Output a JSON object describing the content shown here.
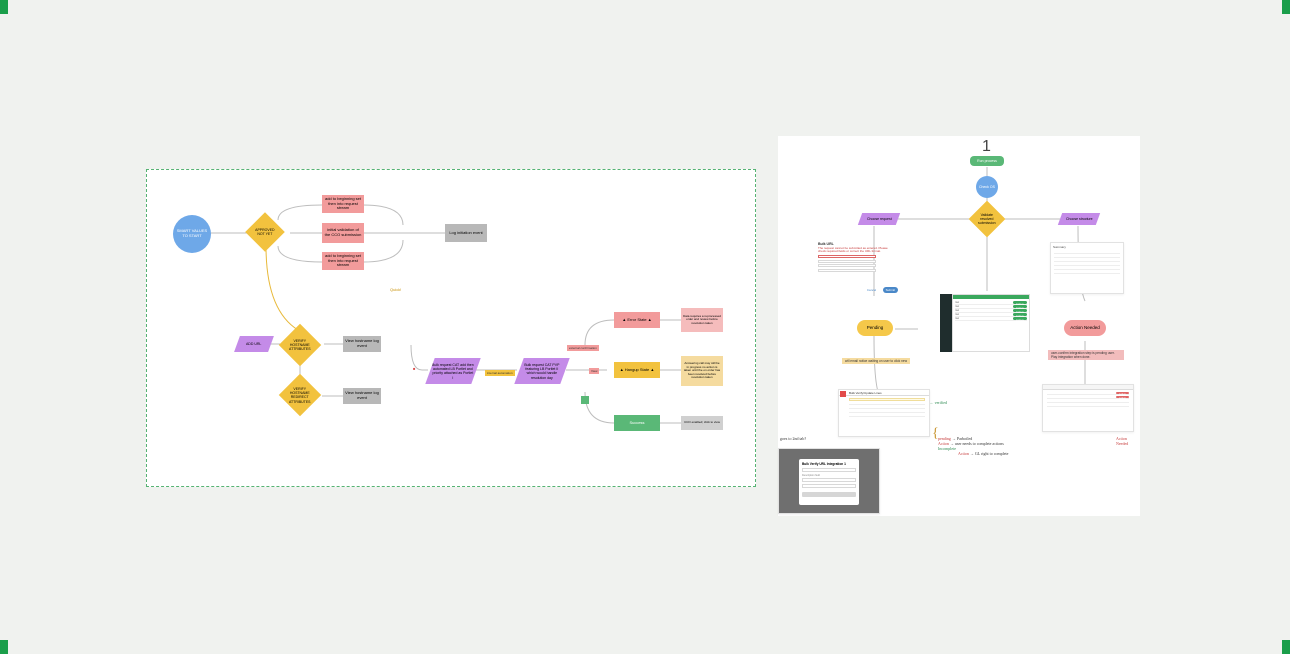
{
  "left": {
    "start": "SMART VALUES TO START",
    "d1": "APPROVED NOT YET",
    "pink1": "add to beginning set then into request stream",
    "pink2": "initial validation of the CCO submission",
    "pink3": "add to beginning set then into request stream",
    "grey1": "Log initiation event",
    "p_addurl": "ADD URL",
    "d2": "VERIFY HOSTNAME ATTRIBUTES",
    "grey2": "View hostname log event",
    "d3": "VERIFY HOSTNAME REDIRECT ATTRIBUTES",
    "grey3": "View hostname log event",
    "p_sendcat": "Bulk request CAT add then automated LB Portlet and priority attached as Portlet I",
    "p_sendcat2": "Bulk request CAT PVP featuring LB Portlet II which would handle resolution day",
    "yellow_edge": "Quick!",
    "error": "▲ Error State ▲",
    "hangup": "▲ Hangup State ▲",
    "success": "Success",
    "side_error": "Data requires a reprocessed order and review before resolution taken",
    "side_hangup": "Answering call may still be in progress no action is taken until the on order has been resolved before resolution taken",
    "side_success": "CCO enabled; click to view",
    "s_label1": "external confirmation",
    "s_label2": "internal automation",
    "s_label3": "View"
  },
  "right": {
    "number": "1",
    "green_top": "Run process",
    "circle": "Check OS",
    "d1": "Validate resolved submission",
    "p_left": "Choose request",
    "p_right": "Choose structure",
    "form_title": "Bulk URL",
    "form_red": "The request cannot be submitted as entered. Please check required fields or correct the URL format.",
    "pending": "Pending",
    "action_needed": "Action Needed",
    "yellow_note": "will email notice waiting on user to click new",
    "red_note": "user-confirm integration step is pending user. Play integration when done.",
    "hand_left": "goes to 2nd tab?",
    "hand_pending_label": "pending",
    "hand_pending_def": "→ Parboiled",
    "hand_action_label": "Action",
    "hand_action_def": "→ user needs to complete actions",
    "hand_incomplete_label": "Incomplete",
    "hand_action2": "→ GL right to complete",
    "hand_actionneeded": "Action Needed",
    "modal_title": "Bulk Verify URL Integration 1"
  }
}
